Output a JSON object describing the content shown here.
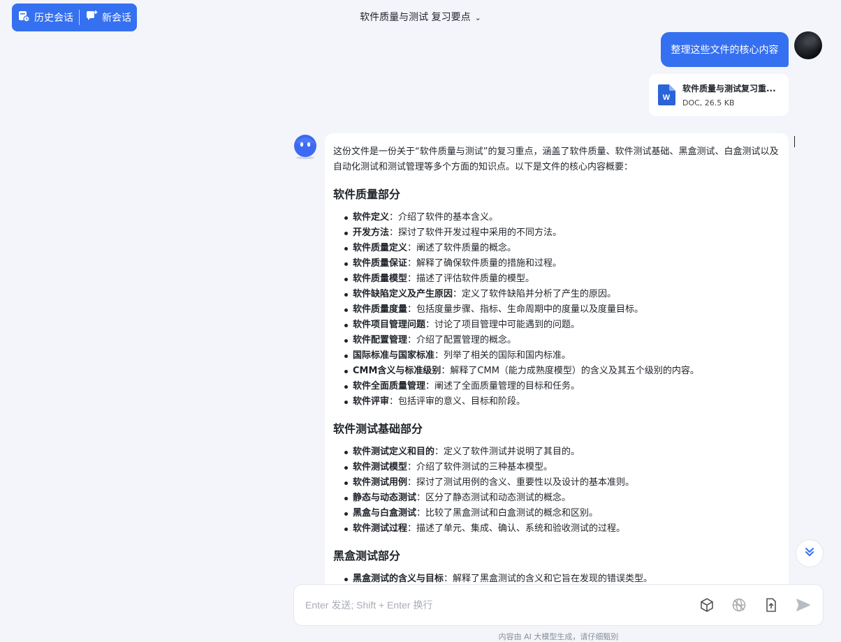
{
  "topbar": {
    "history_label": "历史会话",
    "new_chat_label": "新会话",
    "conversation_title": "软件质量与测试 复习要点"
  },
  "user_message": {
    "text": "整理这些文件的核心内容",
    "file": {
      "name": "软件质量与测试复习重...",
      "meta": "DOC, 26.5 KB"
    }
  },
  "bot_message": {
    "intro": "这份文件是一份关于“软件质量与测试”的复习重点，涵盖了软件质量、软件测试基础、黑盒测试、白盒测试以及自动化测试和测试管理等多个方面的知识点。以下是文件的核心内容概要：",
    "sections": [
      {
        "heading": "软件质量部分",
        "items": [
          {
            "term": "软件定义",
            "desc": "：介绍了软件的基本含义。"
          },
          {
            "term": "开发方法",
            "desc": "：探讨了软件开发过程中采用的不同方法。"
          },
          {
            "term": "软件质量定义",
            "desc": "：阐述了软件质量的概念。"
          },
          {
            "term": "软件质量保证",
            "desc": "：解释了确保软件质量的措施和过程。"
          },
          {
            "term": "软件质量模型",
            "desc": "：描述了评估软件质量的模型。"
          },
          {
            "term": "软件缺陷定义及产生原因",
            "desc": "：定义了软件缺陷并分析了产生的原因。"
          },
          {
            "term": "软件质量度量",
            "desc": "：包括度量步骤、指标、生命周期中的度量以及度量目标。"
          },
          {
            "term": "软件项目管理问题",
            "desc": "：讨论了项目管理中可能遇到的问题。"
          },
          {
            "term": "软件配置管理",
            "desc": "：介绍了配置管理的概念。"
          },
          {
            "term": "国际标准与国家标准",
            "desc": "：列举了相关的国际和国内标准。"
          },
          {
            "term": "CMM含义与标准级别",
            "desc": "：解释了CMM（能力成熟度模型）的含义及其五个级别的内容。"
          },
          {
            "term": "软件全面质量管理",
            "desc": "：阐述了全面质量管理的目标和任务。"
          },
          {
            "term": "软件评审",
            "desc": "：包括评审的意义、目标和阶段。"
          }
        ]
      },
      {
        "heading": "软件测试基础部分",
        "items": [
          {
            "term": "软件测试定义和目的",
            "desc": "：定义了软件测试并说明了其目的。"
          },
          {
            "term": "软件测试模型",
            "desc": "：介绍了软件测试的三种基本模型。"
          },
          {
            "term": "软件测试用例",
            "desc": "：探讨了测试用例的含义、重要性以及设计的基本准则。"
          },
          {
            "term": "静态与动态测试",
            "desc": "：区分了静态测试和动态测试的概念。"
          },
          {
            "term": "黑盒与白盒测试",
            "desc": "：比较了黑盒测试和白盒测试的概念和区别。"
          },
          {
            "term": "软件测试过程",
            "desc": "：描述了单元、集成、确认、系统和验收测试的过程。"
          }
        ]
      },
      {
        "heading": "黑盒测试部分",
        "items": [
          {
            "term": "黑盒测试的含义与目标",
            "desc": "：解释了黑盒测试的含义和它旨在发现的错误类型。"
          }
        ]
      }
    ]
  },
  "input": {
    "placeholder": "Enter 发送; Shift + Enter 换行",
    "value": ""
  },
  "disclaimer": "内容由 AI 大模型生成，请仔细甄别",
  "icons": [
    "history-icon",
    "new-chat-icon",
    "chevron-down-icon",
    "word-file-icon",
    "bot-avatar-icon",
    "scroll-down-icon",
    "cube-icon",
    "web-search-icon",
    "upload-file-icon",
    "send-icon"
  ],
  "colors": {
    "accent": "#3470f0",
    "background": "#f3f5fa"
  }
}
